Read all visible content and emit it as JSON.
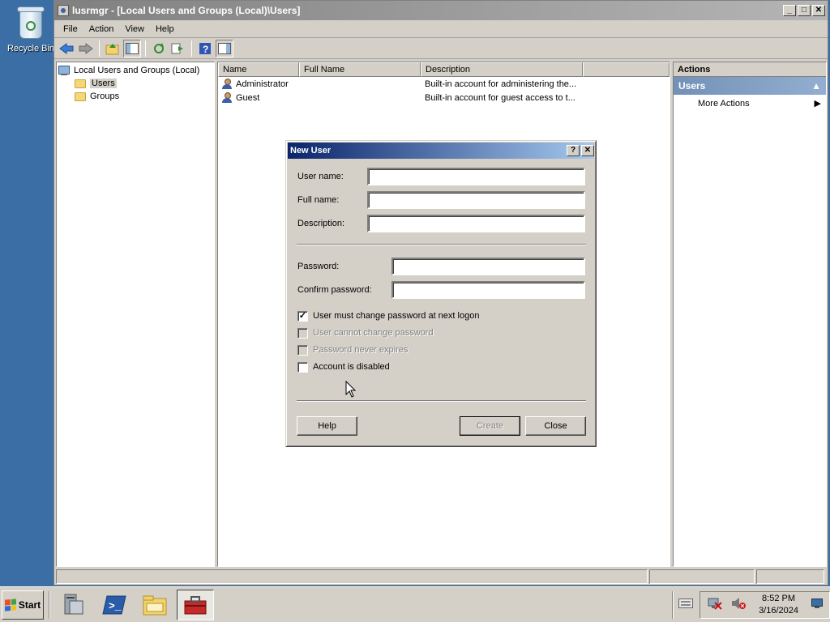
{
  "desktop": {
    "recycle_label": "Recycle Bin"
  },
  "window": {
    "title": "lusrmgr - [Local Users and Groups (Local)\\Users]",
    "minimize": "_",
    "maximize": "□",
    "close": "✕"
  },
  "menu": [
    "File",
    "Action",
    "View",
    "Help"
  ],
  "tree": {
    "root": "Local Users and Groups (Local)",
    "items": [
      "Users",
      "Groups"
    ],
    "selected": "Users"
  },
  "list": {
    "columns": [
      "Name",
      "Full Name",
      "Description"
    ],
    "rows": [
      {
        "name": "Administrator",
        "full_name": "",
        "description": "Built-in account for administering the..."
      },
      {
        "name": "Guest",
        "full_name": "",
        "description": "Built-in account for guest access to t..."
      }
    ]
  },
  "actions": {
    "header": "Actions",
    "section": "Users",
    "items": [
      "More Actions"
    ]
  },
  "dialog": {
    "title": "New User",
    "help_glyph": "?",
    "close_glyph": "✕",
    "labels": {
      "user_name": "User name:",
      "full_name": "Full name:",
      "description": "Description:",
      "password": "Password:",
      "confirm_password": "Confirm password:"
    },
    "values": {
      "user_name": "",
      "full_name": "",
      "description": "",
      "password": "",
      "confirm_password": ""
    },
    "checkboxes": [
      {
        "label": "User must change password at next logon",
        "checked": true,
        "enabled": true
      },
      {
        "label": "User cannot change password",
        "checked": false,
        "enabled": false
      },
      {
        "label": "Password never expires",
        "checked": false,
        "enabled": false
      },
      {
        "label": "Account is disabled",
        "checked": false,
        "enabled": true
      }
    ],
    "buttons": {
      "help": "Help",
      "create": "Create",
      "close": "Close"
    }
  },
  "taskbar": {
    "start_label": "Start",
    "clock_time": "8:52 PM",
    "clock_date": "3/16/2024"
  }
}
